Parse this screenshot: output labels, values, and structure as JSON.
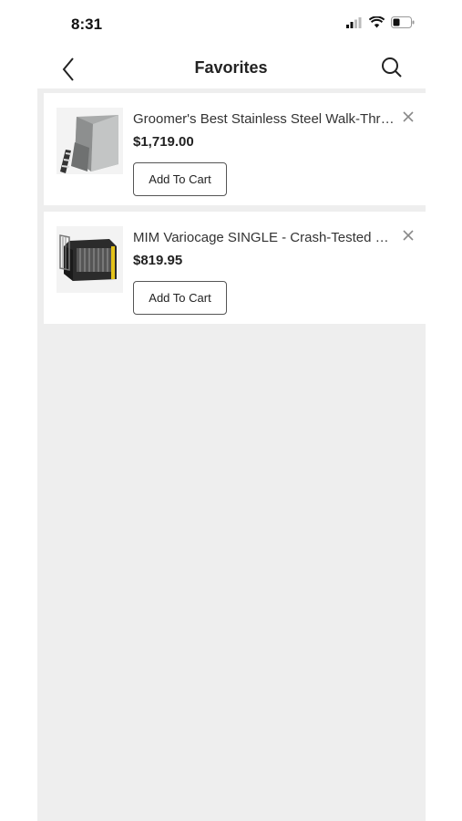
{
  "status_bar": {
    "time": "8:31",
    "icons": [
      "signal-icon",
      "wifi-icon",
      "battery-icon"
    ]
  },
  "header": {
    "title": "Favorites",
    "back_icon": "chevron-left-icon",
    "search_icon": "search-icon"
  },
  "favorites": [
    {
      "title": "Groomer's Best Stainless Steel Walk-Through Tub",
      "display_title": "Groomer's Best Stainless Steel Walk-Thro...",
      "price": "$1,719.00",
      "button_label": "Add To Cart",
      "image": "stainless-steel-tub-image"
    },
    {
      "title": "MIM Variocage SINGLE - Crash-Tested Dog Crate",
      "display_title": "MIM Variocage SINGLE - Crash-Tested Do...",
      "price": "$819.95",
      "button_label": "Add To Cart",
      "image": "dog-crate-image"
    }
  ],
  "colors": {
    "background": "#ffffff",
    "list_background": "#eeeeee",
    "card": "#ffffff",
    "text": "#222222"
  }
}
